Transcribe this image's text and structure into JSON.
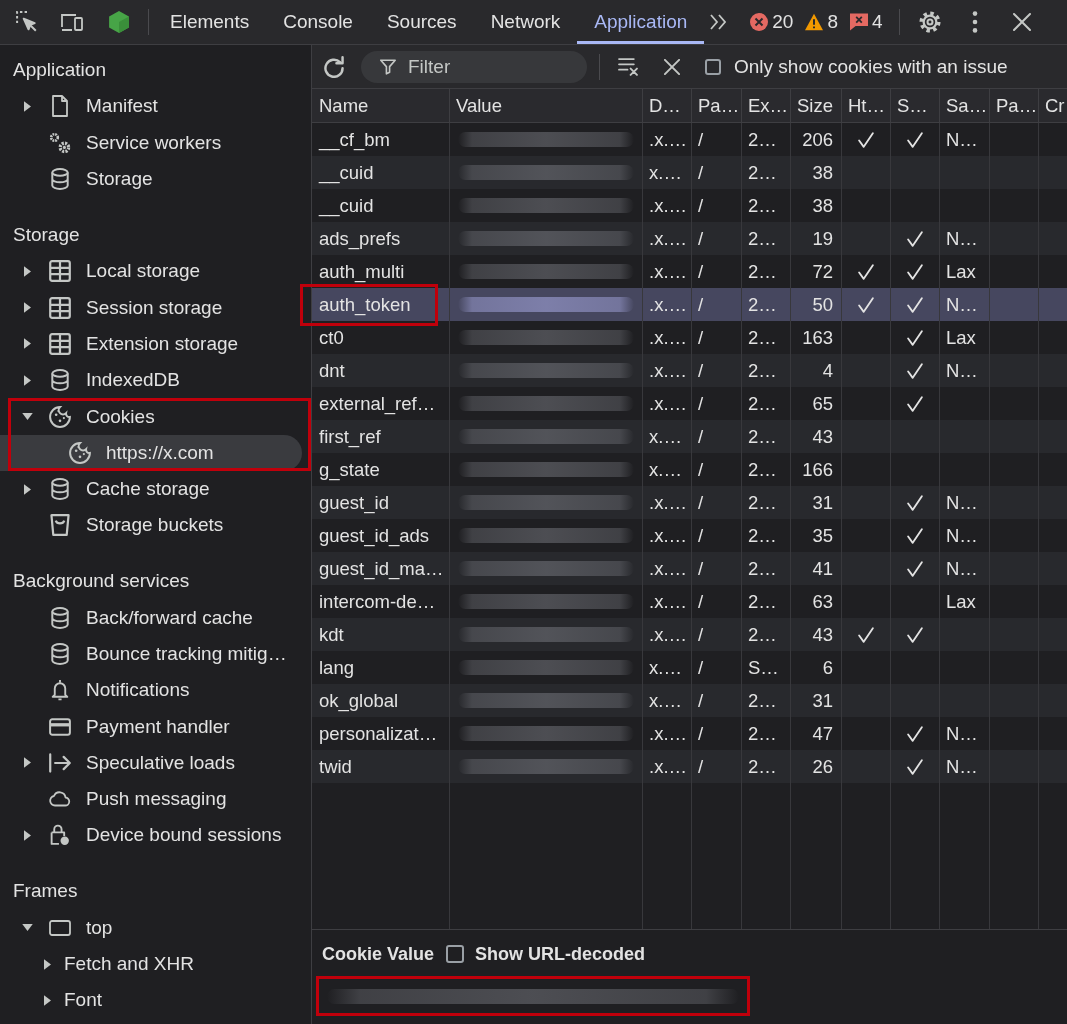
{
  "toolbar": {
    "tabs": [
      {
        "label": "Elements",
        "selected": false
      },
      {
        "label": "Console",
        "selected": false
      },
      {
        "label": "Sources",
        "selected": false
      },
      {
        "label": "Network",
        "selected": false
      },
      {
        "label": "Application",
        "selected": true
      }
    ],
    "badges": [
      {
        "kind": "error",
        "count": "20"
      },
      {
        "kind": "warning",
        "count": "8"
      },
      {
        "kind": "issue",
        "count": "4"
      }
    ]
  },
  "sidebar": {
    "sections": [
      {
        "title": "Application",
        "items": [
          {
            "label": "Manifest",
            "kind": "file",
            "expanded": false,
            "selected": false,
            "outlined": false
          },
          {
            "label": "Service workers",
            "kind": "gears",
            "selected": false,
            "outlined": false
          },
          {
            "label": "Storage",
            "kind": "database",
            "selected": false,
            "outlined": false
          }
        ]
      },
      {
        "title": "Storage",
        "items": [
          {
            "label": "Local storage",
            "kind": "table",
            "expanded": false,
            "selected": false,
            "outlined": false
          },
          {
            "label": "Session storage",
            "kind": "table",
            "expanded": false,
            "selected": false,
            "outlined": false
          },
          {
            "label": "Extension storage",
            "kind": "table",
            "expanded": false,
            "selected": false,
            "outlined": false
          },
          {
            "label": "IndexedDB",
            "kind": "database",
            "expanded": false,
            "selected": false,
            "outlined": false
          },
          {
            "label": "Cookies",
            "kind": "cookie",
            "expanded": true,
            "selected": false,
            "outlined": true,
            "children": [
              {
                "label": "https://x.com",
                "kind": "cookie",
                "selected": true,
                "outlined": false
              }
            ]
          },
          {
            "label": "Cache storage",
            "kind": "database",
            "expanded": false,
            "selected": false,
            "outlined": false
          },
          {
            "label": "Storage buckets",
            "kind": "bucket",
            "selected": false,
            "outlined": false
          }
        ]
      },
      {
        "title": "Background services",
        "items": [
          {
            "label": "Back/forward cache",
            "kind": "database",
            "selected": false,
            "outlined": false
          },
          {
            "label": "Bounce tracking mitig…",
            "kind": "database",
            "selected": false,
            "outlined": false
          },
          {
            "label": "Notifications",
            "kind": "bell",
            "selected": false,
            "outlined": false
          },
          {
            "label": "Payment handler",
            "kind": "card",
            "selected": false,
            "outlined": false
          },
          {
            "label": "Speculative loads",
            "kind": "arrow-bar",
            "expanded": false,
            "selected": false,
            "outlined": false
          },
          {
            "label": "Push messaging",
            "kind": "cloud",
            "selected": false,
            "outlined": false
          },
          {
            "label": "Device bound sessions",
            "kind": "lock-person",
            "expanded": false,
            "selected": false,
            "outlined": false
          }
        ]
      },
      {
        "title": "Frames",
        "items": [
          {
            "label": "top",
            "kind": "window",
            "expanded": true,
            "selected": false,
            "outlined": false,
            "children": [
              {
                "label": "Fetch and XHR",
                "kind": "plain",
                "expanded": false,
                "selected": false,
                "outlined": false
              },
              {
                "label": "Font",
                "kind": "plain",
                "expanded": false,
                "selected": false,
                "outlined": false
              }
            ]
          }
        ]
      }
    ]
  },
  "cookie_toolbar": {
    "filter": {
      "placeholder": "Filter"
    },
    "issue_filter": {
      "label": "Only show cookies with an issue",
      "checked": false
    }
  },
  "table": {
    "columns": [
      "Name",
      "Value",
      "D…",
      "Pa…",
      "Ex…",
      "Size",
      "Ht…",
      "S…",
      "Sa…",
      "Pa…",
      "Cr"
    ],
    "rows": [
      {
        "name": "__cf_bm",
        "column_3": ".x.…",
        "column_4": "/",
        "column_5": "2…",
        "size": "206",
        "column_7": true,
        "column_8": true,
        "column_9": "N…",
        "selected": false,
        "outlined": false
      },
      {
        "name": "__cuid",
        "column_3": "x.…",
        "column_4": "/",
        "column_5": "2…",
        "size": "38",
        "column_7": false,
        "column_8": false,
        "selected": false,
        "outlined": false
      },
      {
        "name": "__cuid",
        "column_3": ".x.…",
        "column_4": "/",
        "column_5": "2…",
        "size": "38",
        "column_7": false,
        "column_8": false,
        "selected": false,
        "outlined": false
      },
      {
        "name": "ads_prefs",
        "column_3": ".x.…",
        "column_4": "/",
        "column_5": "2…",
        "size": "19",
        "column_7": false,
        "column_8": true,
        "column_9": "N…",
        "selected": false,
        "outlined": false
      },
      {
        "name": "auth_multi",
        "column_3": ".x.…",
        "column_4": "/",
        "column_5": "2…",
        "size": "72",
        "column_7": true,
        "column_8": true,
        "column_9": "Lax",
        "selected": false,
        "outlined": false
      },
      {
        "name": "auth_token",
        "column_3": ".x.…",
        "column_4": "/",
        "column_5": "2…",
        "size": "50",
        "column_7": true,
        "column_8": true,
        "column_9": "N…",
        "selected": true,
        "outlined": true
      },
      {
        "name": "ct0",
        "column_3": ".x.…",
        "column_4": "/",
        "column_5": "2…",
        "size": "163",
        "column_7": false,
        "column_8": true,
        "column_9": "Lax",
        "selected": false,
        "outlined": false
      },
      {
        "name": "dnt",
        "column_3": ".x.…",
        "column_4": "/",
        "column_5": "2…",
        "size": "4",
        "column_7": false,
        "column_8": true,
        "column_9": "N…",
        "selected": false,
        "outlined": false
      },
      {
        "name": "external_ref…",
        "column_3": ".x.…",
        "column_4": "/",
        "column_5": "2…",
        "size": "65",
        "column_7": false,
        "column_8": true,
        "selected": false,
        "outlined": false
      },
      {
        "name": "first_ref",
        "column_3": "x.…",
        "column_4": "/",
        "column_5": "2…",
        "size": "43",
        "column_7": false,
        "column_8": false,
        "selected": false,
        "outlined": false
      },
      {
        "name": "g_state",
        "column_3": "x.…",
        "column_4": "/",
        "column_5": "2…",
        "size": "166",
        "column_7": false,
        "column_8": false,
        "selected": false,
        "outlined": false
      },
      {
        "name": "guest_id",
        "column_3": ".x.…",
        "column_4": "/",
        "column_5": "2…",
        "size": "31",
        "column_7": false,
        "column_8": true,
        "column_9": "N…",
        "selected": false,
        "outlined": false
      },
      {
        "name": "guest_id_ads",
        "column_3": ".x.…",
        "column_4": "/",
        "column_5": "2…",
        "size": "35",
        "column_7": false,
        "column_8": true,
        "column_9": "N…",
        "selected": false,
        "outlined": false
      },
      {
        "name": "guest_id_ma…",
        "column_3": ".x.…",
        "column_4": "/",
        "column_5": "2…",
        "size": "41",
        "column_7": false,
        "column_8": true,
        "column_9": "N…",
        "selected": false,
        "outlined": false
      },
      {
        "name": "intercom-de…",
        "column_3": ".x.…",
        "column_4": "/",
        "column_5": "2…",
        "size": "63",
        "column_7": false,
        "column_8": false,
        "column_9": "Lax",
        "selected": false,
        "outlined": false
      },
      {
        "name": "kdt",
        "column_3": ".x.…",
        "column_4": "/",
        "column_5": "2…",
        "size": "43",
        "column_7": true,
        "column_8": true,
        "selected": false,
        "outlined": false
      },
      {
        "name": "lang",
        "column_3": "x.…",
        "column_4": "/",
        "column_5": "S…",
        "size": "6",
        "column_7": false,
        "column_8": false,
        "selected": false,
        "outlined": false
      },
      {
        "name": "ok_global",
        "column_3": "x.…",
        "column_4": "/",
        "column_5": "2…",
        "size": "31",
        "column_7": false,
        "column_8": false,
        "selected": false,
        "outlined": false
      },
      {
        "name": "personalizat…",
        "column_3": ".x.…",
        "column_4": "/",
        "column_5": "2…",
        "size": "47",
        "column_7": false,
        "column_8": true,
        "column_9": "N…",
        "selected": false,
        "outlined": false
      },
      {
        "name": "twid",
        "column_3": ".x.…",
        "column_4": "/",
        "column_5": "2…",
        "size": "26",
        "column_7": false,
        "column_8": true,
        "column_9": "N…",
        "selected": false,
        "outlined": false
      }
    ]
  },
  "cookie_value": {
    "title": "Cookie Value",
    "decode_label": "Show URL-decoded",
    "decoded": false,
    "outlined": true
  }
}
